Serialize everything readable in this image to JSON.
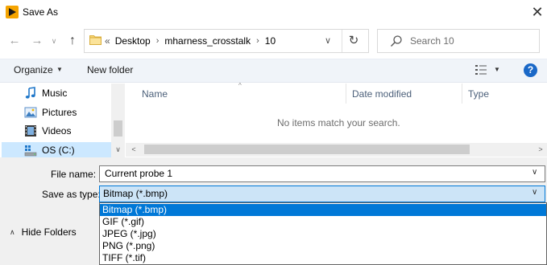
{
  "window": {
    "title": "Save As",
    "close_glyph": "✕",
    "app_icon": "app-logo-icon"
  },
  "nav": {
    "back_glyph": "←",
    "forward_glyph": "→",
    "recent_glyph": "∨",
    "up_glyph": "↑",
    "breadcrumb_prefix": "«",
    "breadcrumbs": [
      "Desktop",
      "mharness_crosstalk",
      "10"
    ],
    "separator": "›",
    "address_dropdown_glyph": "∨",
    "refresh_glyph": "↻"
  },
  "search": {
    "placeholder": "Search 10"
  },
  "toolbar": {
    "organize_label": "Organize",
    "dropdown_caret": "▼",
    "new_folder_label": "New folder",
    "help_glyph": "?"
  },
  "sidebar": {
    "items": [
      {
        "label": "Music",
        "icon": "music-icon"
      },
      {
        "label": "Pictures",
        "icon": "pictures-icon"
      },
      {
        "label": "Videos",
        "icon": "videos-icon"
      },
      {
        "label": "OS (C:)",
        "icon": "drive-icon",
        "selected": true
      }
    ],
    "scroll_down_glyph": "∨"
  },
  "filelist": {
    "columns": [
      "Name",
      "Date modified",
      "Type"
    ],
    "sort_glyph": "^",
    "empty_message": "No items match your search.",
    "scroll_left_glyph": "<",
    "scroll_right_glyph": ">"
  },
  "form": {
    "filename_label": "File name:",
    "filename_value": "Current probe 1",
    "savetype_label": "Save as type:",
    "savetype_value": "Bitmap (*.bmp)",
    "combo_caret": "∨",
    "type_options": [
      "Bitmap (*.bmp)",
      "GIF (*.gif)",
      "JPEG (*.jpg)",
      "PNG (*.png)",
      "TIFF (*.tif)"
    ],
    "selected_option_index": 0
  },
  "footer": {
    "hide_folders_label": "Hide Folders",
    "hide_folders_glyph": "∧"
  },
  "colors": {
    "accent": "#0078d7",
    "help_blue": "#1a68c7",
    "selected_bg": "#cce8ff",
    "combo_bg": "#cce4f7"
  }
}
